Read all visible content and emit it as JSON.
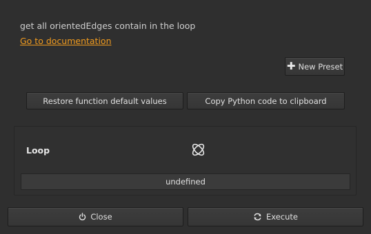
{
  "description": "get all orientedEdges contain in the loop",
  "doc_link": "Go to documentation",
  "presets": {
    "new_preset_label": "New Preset"
  },
  "actions": {
    "restore_label": "Restore function default values",
    "copy_python_label": "Copy Python code to clipboard"
  },
  "parameter": {
    "label": "Loop",
    "icon": "loop-node-icon",
    "value": "undefined"
  },
  "footer": {
    "close_label": "Close",
    "close_icon": "power-icon",
    "execute_label": "Execute",
    "execute_icon": "refresh-icon"
  },
  "colors": {
    "background": "#2f2f2f",
    "link": "#f29c1f",
    "text": "#d6d6d6"
  }
}
